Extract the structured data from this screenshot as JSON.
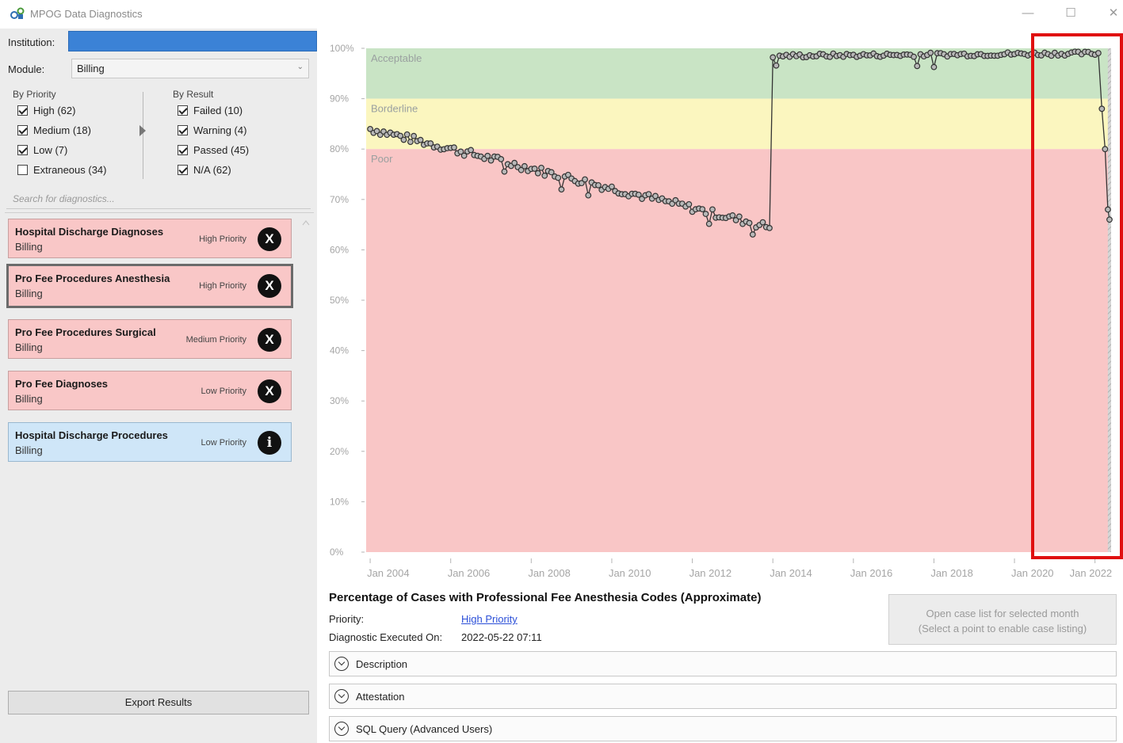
{
  "window": {
    "title": "MPOG Data Diagnostics",
    "minimize_glyph": "—",
    "maximize_glyph": "☐",
    "close_glyph": "✕"
  },
  "filters": {
    "institution_label": "Institution:",
    "module_label": "Module:",
    "module_value": "Billing",
    "by_priority_title": "By Priority",
    "by_result_title": "By Result",
    "priority": [
      {
        "label": "High (62)",
        "checked": true
      },
      {
        "label": "Medium (18)",
        "checked": true
      },
      {
        "label": "Low (7)",
        "checked": true
      },
      {
        "label": "Extraneous (34)",
        "checked": false
      }
    ],
    "result": [
      {
        "label": "Failed (10)",
        "checked": true
      },
      {
        "label": "Warning (4)",
        "checked": true
      },
      {
        "label": "Passed (45)",
        "checked": true
      },
      {
        "label": "N/A (62)",
        "checked": true
      }
    ],
    "search_placeholder": "Search for diagnostics..."
  },
  "diagnostics": [
    {
      "title": "Hospital Discharge Diagnoses",
      "module": "Billing",
      "priority": "High Priority",
      "status": "failed",
      "badge": "X"
    },
    {
      "title": "Pro Fee Procedures Anesthesia",
      "module": "Billing",
      "priority": "High Priority",
      "status": "failed",
      "badge": "X",
      "selected": true
    },
    {
      "title": "Pro Fee Procedures Surgical",
      "module": "Billing",
      "priority": "Medium Priority",
      "status": "failed",
      "badge": "X"
    },
    {
      "title": "Pro Fee Diagnoses",
      "module": "Billing",
      "priority": "Low Priority",
      "status": "failed",
      "badge": "X"
    },
    {
      "title": "Hospital Discharge Procedures",
      "module": "Billing",
      "priority": "Low Priority",
      "status": "info",
      "badge": "i"
    }
  ],
  "export_label": "Export Results",
  "chart_data": {
    "type": "line",
    "y_ticks": [
      "0%",
      "10%",
      "20%",
      "30%",
      "40%",
      "50%",
      "60%",
      "70%",
      "80%",
      "90%",
      "100%"
    ],
    "x_ticks": [
      "Jan 2004",
      "Jan 2006",
      "Jan 2008",
      "Jan 2010",
      "Jan 2012",
      "Jan 2014",
      "Jan 2016",
      "Jan 2018",
      "Jan 2020",
      "Jan 2022"
    ],
    "ylim": [
      0,
      100
    ],
    "xlim": [
      2003.9,
      2022.4
    ],
    "bands": [
      {
        "label": "Acceptable",
        "from": 90,
        "to": 100,
        "color": "#c9e4c5"
      },
      {
        "label": "Borderline",
        "from": 80,
        "to": 90,
        "color": "#fbf6bf"
      },
      {
        "label": "Poor",
        "from": 0,
        "to": 80,
        "color": "#f9c6c6"
      }
    ],
    "segments": [
      {
        "x_start": 2004.0,
        "x_end": 2013.9,
        "y_start": 84,
        "y_end": 64.5
      },
      {
        "x_start": 2014.0,
        "x_end": 2022.1,
        "y_start": 98.5,
        "y_end": 99.0
      }
    ],
    "tail_points": [
      [
        2022.17,
        88
      ],
      [
        2022.25,
        80
      ],
      [
        2022.32,
        68
      ],
      [
        2022.36,
        66
      ]
    ],
    "incomplete_region_start": 2022.2
  },
  "details": {
    "title": "Percentage of Cases with Professional Fee Anesthesia Codes (Approximate)",
    "priority_label": "Priority:",
    "priority_value": "High Priority",
    "executed_label": "Diagnostic Executed On:",
    "executed_value": "2022-05-22 07:11",
    "open_button_line1": "Open case list for selected month",
    "open_button_line2": "(Select a point to enable case listing)",
    "expanders": [
      "Description",
      "Attestation",
      "SQL Query (Advanced Users)"
    ]
  },
  "colors": {
    "highlight_box": "#e01010",
    "accent": "#3b82d6",
    "failed_card": "#f9c7c7",
    "info_card": "#cfe6f8"
  }
}
